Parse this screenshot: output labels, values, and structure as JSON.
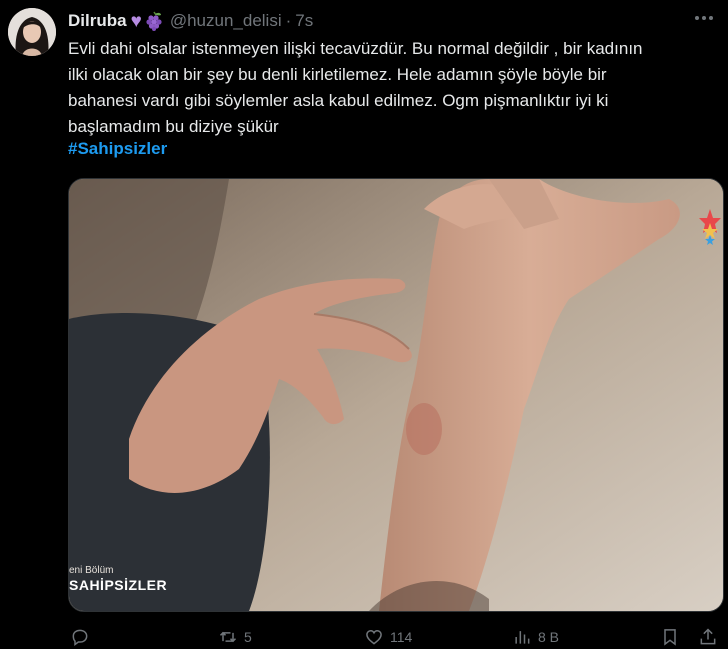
{
  "tweet": {
    "author_name": "Dilruba",
    "handle": "@huzun_delisi",
    "separator": "·",
    "time": "7s",
    "text_lines": [
      "Evli dahi olsalar istenmeyen ilişki tecavüzdür. Bu normal değildir , bir kadının",
      "ilki olacak olan bir şey bu denli kirletilemez. Hele adamın şöyle böyle bir",
      "bahanesi vardı gibi söylemler asla kabul edilmez. Ogm pişmanlıktır iyi ki",
      "başlamadım bu diziye şükür"
    ],
    "hashtag": "#Sahipsizler",
    "media": {
      "overlay_small": "eni Bölüm",
      "overlay_big": "SAHİPSİZLER"
    },
    "actions": {
      "reply_count": "",
      "retweet_count": "5",
      "like_count": "114",
      "views_count": "8 B"
    }
  },
  "colors": {
    "background": "#000000",
    "text": "#e7e9ea",
    "muted": "#71767b",
    "link": "#1d9bf0",
    "emoji_heart": "#b68ce3"
  },
  "icons": [
    "more-icon",
    "purple-heart-icon",
    "grapes-icon",
    "reply-icon",
    "retweet-icon",
    "like-icon",
    "views-icon",
    "bookmark-icon",
    "share-icon"
  ]
}
